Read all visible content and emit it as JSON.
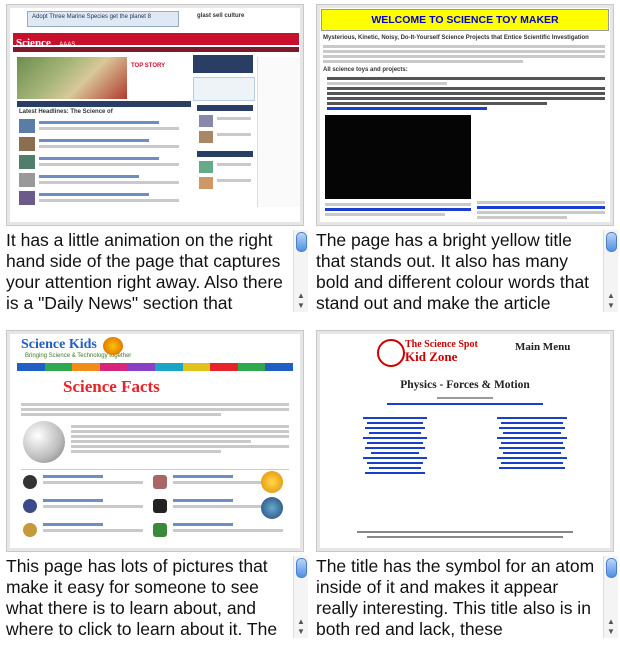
{
  "cells": [
    {
      "site": {
        "banner_text": "Adopt Three Marine Species get the planet 8",
        "ad_text": "glast sell culture",
        "brand": "Science",
        "aaas": "AAAS",
        "section_title": "Latest Headlines: The Science of"
      },
      "note": "It has a little animation on the right hand side of the page that captures your attention right away. Also there is a \"Daily News\" section that"
    },
    {
      "site": {
        "title": "WELCOME TO SCIENCE TOY MAKER",
        "subtitle": "Mysterious, Kinetic, Noisy, Do-It-Yourself Science Projects that Entice Scientific Investigation",
        "list_heading": "All science toys and projects:"
      },
      "note": "The page has a bright yellow title that stands out. It also has many bold and different colour words that stand out and make the article"
    },
    {
      "site": {
        "logo": "Science Kids",
        "tagline": "Bringing Science & Technology together",
        "heading": "Science Facts"
      },
      "note": "This page has lots of pictures that make it easy for someone to see what there is to learn about, and where to click to learn about it. The"
    },
    {
      "site": {
        "logo_line1": "The Science Spot",
        "logo_line2": "Kid Zone",
        "menu": "Main Menu",
        "title": "Physics - Forces & Motion"
      },
      "note": "The title has the symbol for an atom inside of it and makes it appear really interesting. This title also is in both red and lack, these"
    }
  ],
  "colors": {
    "yellow": "#ffff00",
    "science_red": "#c8102e",
    "kids_red": "#e8232a",
    "link_blue": "#1a3fd0"
  },
  "scrollbar": {
    "up_arrow": "▲",
    "down_arrow": "▼"
  }
}
